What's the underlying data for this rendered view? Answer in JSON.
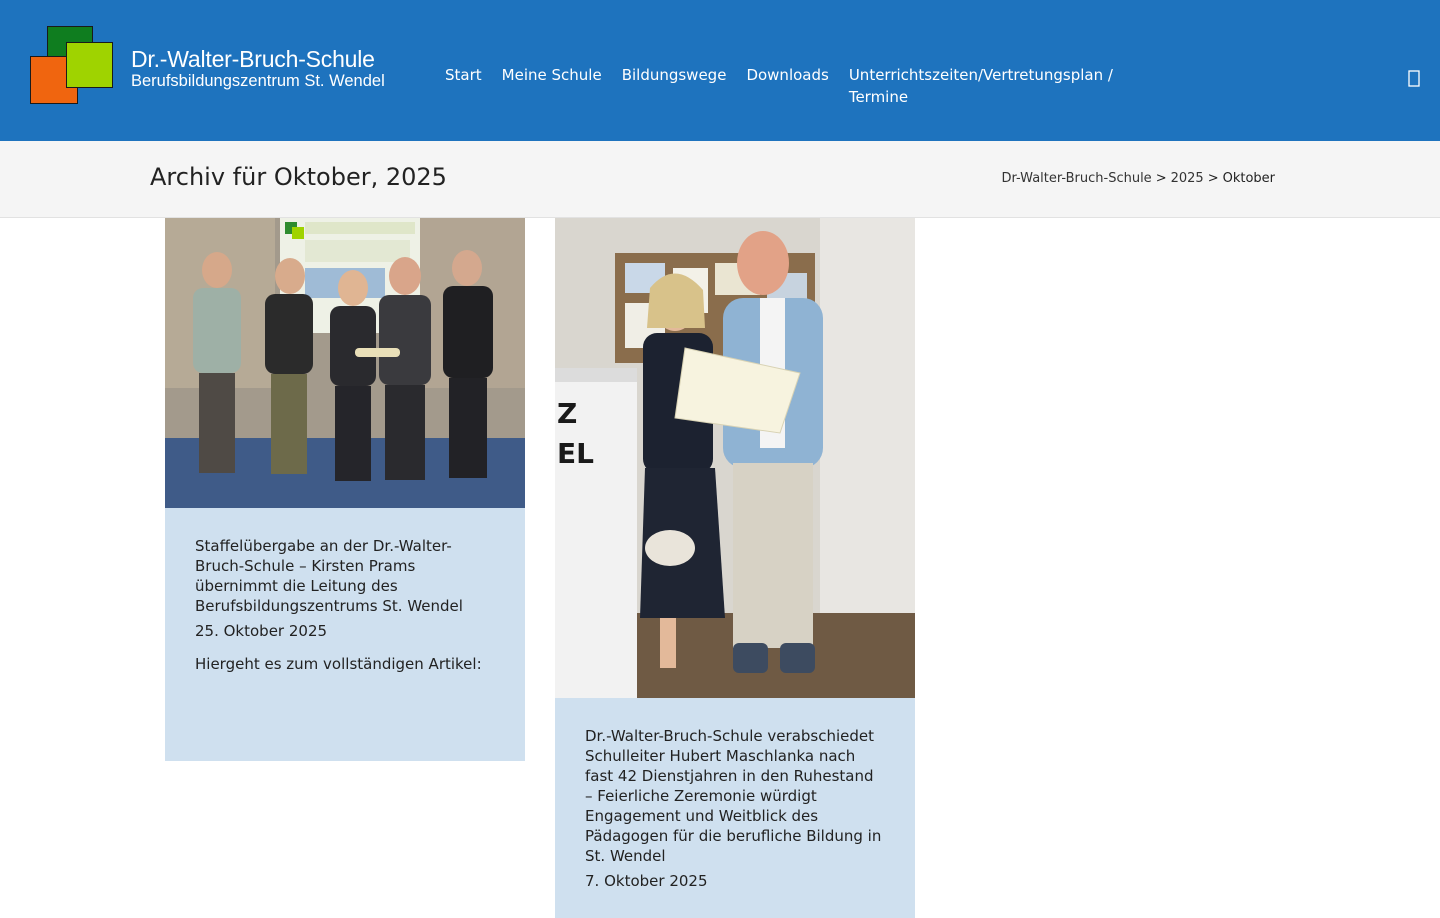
{
  "header": {
    "logo": {
      "title": "Dr.-Walter-Bruch-Schule",
      "subtitle": "Berufsbildungszentrum St. Wendel",
      "colors": [
        "#0f7d1f",
        "#f0650f",
        "#9fd300"
      ]
    },
    "nav": [
      {
        "label": "Start"
      },
      {
        "label": "Meine Schule"
      },
      {
        "label": "Bildungswege"
      },
      {
        "label": "Downloads"
      },
      {
        "label": "Unterrichtszeiten/Vertretungsplan / Termine"
      }
    ],
    "search_icon": "search-icon",
    "background": "#1e73be"
  },
  "title_bar": {
    "title": "Archiv für Oktober, 2025",
    "breadcrumb": {
      "items": [
        "Dr-Walter-Bruch-Schule",
        "2025"
      ],
      "separator": ">",
      "current": "Oktober"
    }
  },
  "posts": [
    {
      "image": "group-photo-five-people",
      "title": "Staffelübergabe an der Dr.-Walter-Bruch-Schule – Kirsten Prams übernimmt die Leitung des Berufsbildungszentrums St. Wendel",
      "date": "25. Oktober 2025",
      "excerpt": "Hiergeht es zum vollständigen Artikel:"
    },
    {
      "image": "certificate-handover-photo",
      "title": "Dr.-Walter-Bruch-Schule verabschiedet Schulleiter Hubert Maschlanka nach fast 42 Dienstjahren in den Ruhestand – Feierliche Zeremonie würdigt Engagement und Weitblick des Pädagogen für die berufliche Bildung in St. Wendel",
      "date": "7. Oktober 2025",
      "excerpt": ""
    }
  ],
  "colors": {
    "card_background": "#cfe0ef",
    "title_bar_background": "#f5f5f5"
  }
}
